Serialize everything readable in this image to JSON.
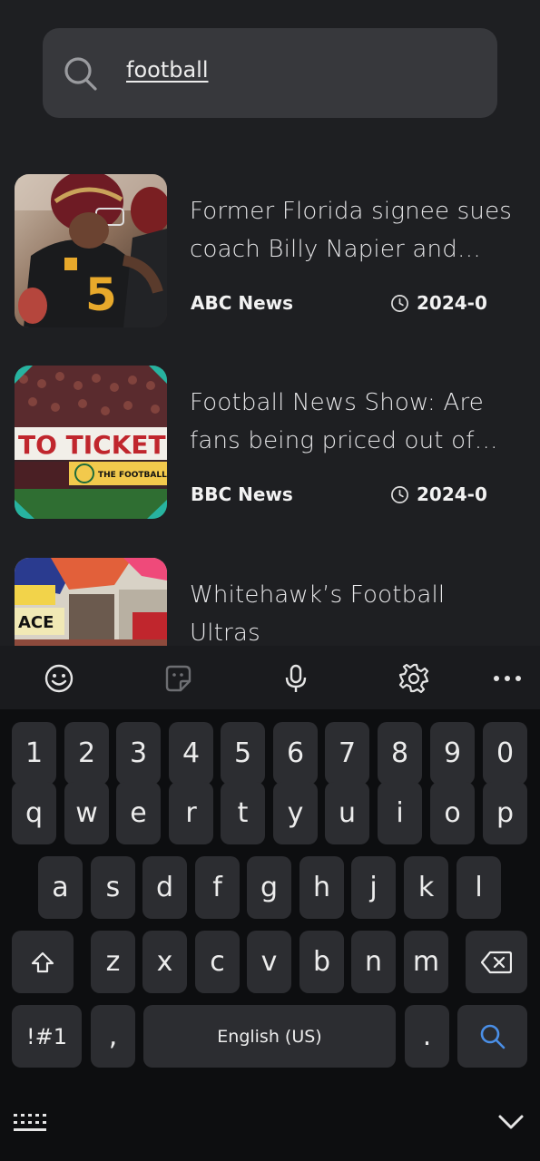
{
  "search": {
    "query": "football"
  },
  "news": [
    {
      "title": "Former Florida signee sues coach Billy Napier and others",
      "source": "ABC News",
      "date": "2024-0"
    },
    {
      "title": "Football News Show: Are fans being priced out of the game",
      "source": "BBC News",
      "date": "2024-0"
    },
    {
      "title": "Whitehawk’s Football Ultras",
      "source": "",
      "date": ""
    }
  ],
  "thumbs": {
    "banner1": "TO TICKET PRICE",
    "banner2": "THE FOOTBALL N"
  },
  "keyboard": {
    "toolbar": [
      "emoji-icon",
      "sticker-icon",
      "microphone-icon",
      "settings-icon",
      "more-icon"
    ],
    "row_numbers": [
      "1",
      "2",
      "3",
      "4",
      "5",
      "6",
      "7",
      "8",
      "9",
      "0"
    ],
    "row1": [
      "q",
      "w",
      "e",
      "r",
      "t",
      "y",
      "u",
      "i",
      "o",
      "p"
    ],
    "row2": [
      "a",
      "s",
      "d",
      "f",
      "g",
      "h",
      "j",
      "k",
      "l"
    ],
    "row3": [
      "z",
      "x",
      "c",
      "v",
      "b",
      "n",
      "m"
    ],
    "symbols_label": "!#1",
    "comma_label": ",",
    "space_label": "English (US)",
    "period_label": "."
  },
  "colors": {
    "background": "#1e1f22",
    "search_bg": "#37383c",
    "key_bg": "#2c2d31",
    "search_accent": "#4a8fe7"
  }
}
